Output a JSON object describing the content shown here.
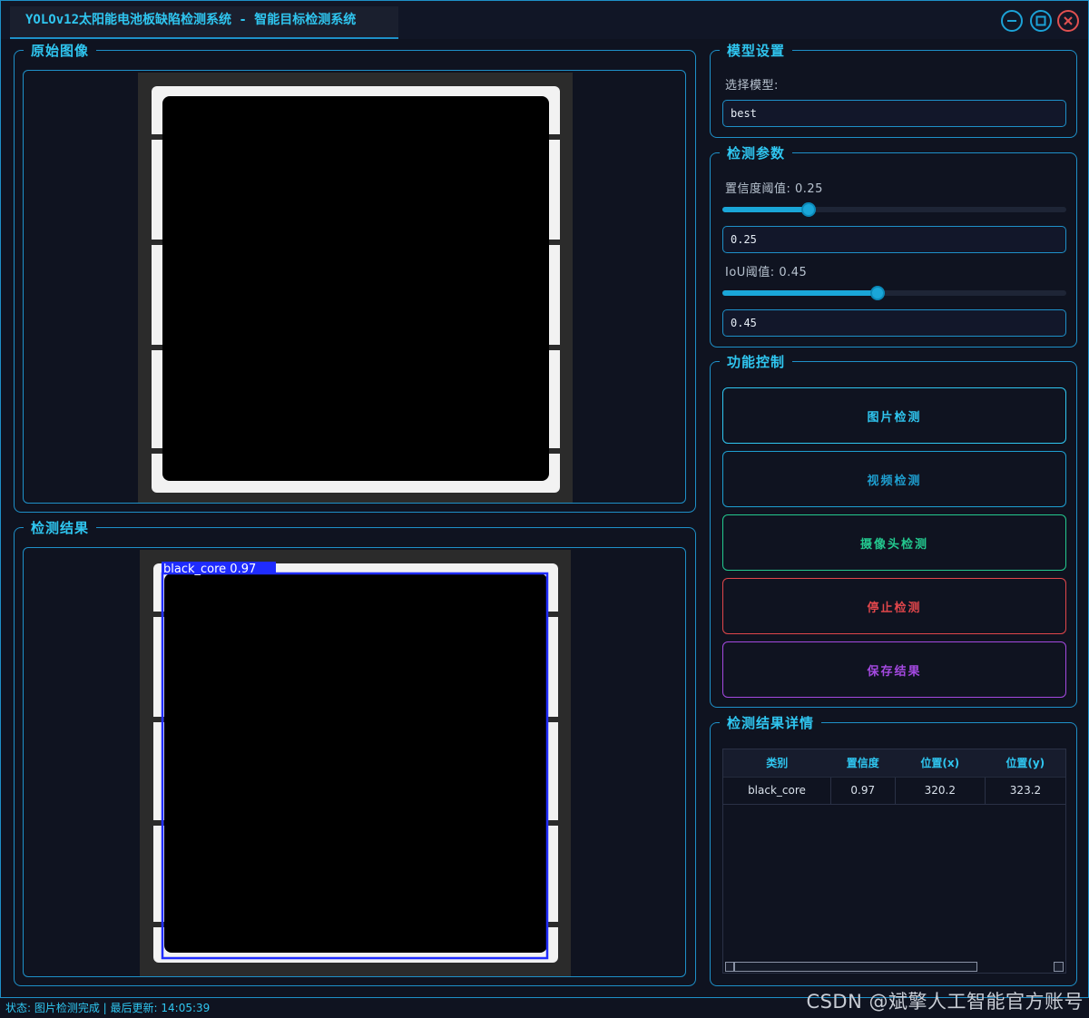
{
  "window": {
    "title": "YOLOv12太阳能电池板缺陷检测系统 - 智能目标检测系统"
  },
  "panels": {
    "original": {
      "title": "原始图像"
    },
    "result": {
      "title": "检测结果"
    },
    "model": {
      "title": "模型设置",
      "select_label": "选择模型:",
      "selected": "best"
    },
    "params": {
      "title": "检测参数",
      "conf_label": "置信度阈值: 0.25",
      "conf_value": 0.25,
      "conf_input": "0.25",
      "iou_label": "IoU阈值: 0.45",
      "iou_value": 0.45,
      "iou_input": "0.45"
    },
    "controls": {
      "title": "功能控制",
      "buttons": [
        {
          "label": "图片检测",
          "color": "#2fc6f0"
        },
        {
          "label": "视频检测",
          "color": "#1e9fd0"
        },
        {
          "label": "摄像头检测",
          "color": "#23c98f"
        },
        {
          "label": "停止检测",
          "color": "#e0464b"
        },
        {
          "label": "保存结果",
          "color": "#a449e0"
        }
      ]
    },
    "details": {
      "title": "检测结果详情",
      "columns": [
        "类别",
        "置信度",
        "位置(x)",
        "位置(y)"
      ],
      "rows": [
        [
          "black_core",
          "0.97",
          "320.2",
          "323.2"
        ]
      ]
    }
  },
  "detection": {
    "label": "black_core 0.97",
    "box_color": "#1f2cff"
  },
  "status": "状态: 图片检测完成 | 最后更新: 14:05:39",
  "watermark": "CSDN @斌擎人工智能官方账号"
}
